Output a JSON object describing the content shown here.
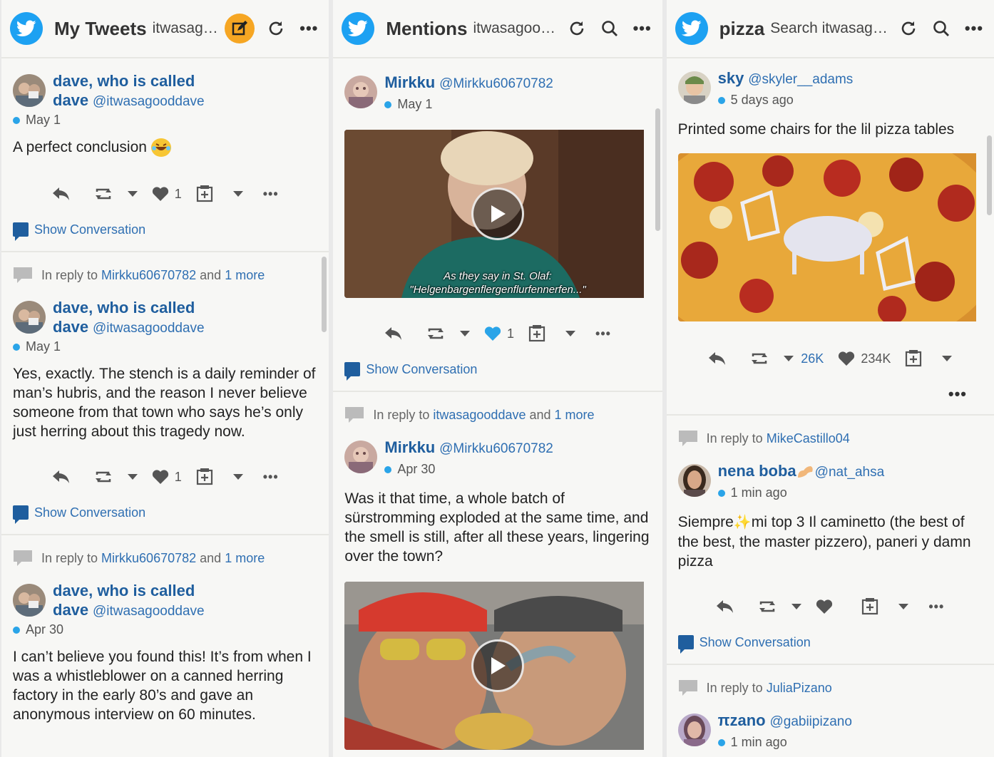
{
  "colors": {
    "accent": "#1da1f2",
    "link": "#2f6fb2",
    "name": "#1f5e9e",
    "compose": "#f6a623",
    "liked": "#2aa4e8"
  },
  "columns": [
    {
      "title": "My Tweets",
      "subtitle": "itwasago…",
      "icons": [
        "twitter-bird-icon",
        "compose-icon",
        "refresh-icon",
        "more-icon"
      ],
      "tweets": [
        {
          "name_line1": "dave, who is called",
          "name_line2": "dave",
          "handle": "@itwasagooddave",
          "time": "May 1",
          "text": "A perfect conclusion",
          "emoji": "laughing-emoji",
          "likes": "1",
          "show_conversation": "Show Conversation"
        },
        {
          "reply_prefix": "In reply to",
          "reply_user": "Mirkku60670782",
          "reply_and": "and",
          "reply_more": "1 more",
          "name_line1": "dave, who is called",
          "name_line2": "dave",
          "handle": "@itwasagooddave",
          "time": "May 1",
          "text": "Yes, exactly. The stench is a daily reminder of man’s hubris, and the reason I never believe someone from that town who says he’s only just herring about this tragedy now.",
          "likes": "1",
          "show_conversation": "Show Conversation"
        },
        {
          "reply_prefix": "In reply to",
          "reply_user": "Mirkku60670782",
          "reply_and": "and",
          "reply_more": "1 more",
          "name_line1": "dave, who is called",
          "name_line2": "dave",
          "handle": "@itwasagooddave",
          "time": "Apr 30",
          "text": "I can’t believe you found this! It’s from when I was a whistleblower on a canned herring factory in the early 80’s and gave an anonymous interview on 60 minutes."
        }
      ]
    },
    {
      "title": "Mentions",
      "subtitle": "itwasagoo…",
      "icons": [
        "twitter-bird-icon",
        "refresh-icon",
        "search-icon",
        "more-icon"
      ],
      "tweets": [
        {
          "name": "Mirkku",
          "handle": "@Mirkku60670782",
          "time": "May 1",
          "video_caption_1": "As they say in St. Olaf:",
          "video_caption_2": "\"Helgenbargenflergenflurfennerfen...\"",
          "likes": "1",
          "show_conversation": "Show Conversation"
        },
        {
          "reply_prefix": "In reply to",
          "reply_user": "itwasagooddave",
          "reply_and": "and",
          "reply_more": "1 more",
          "name": "Mirkku",
          "handle": "@Mirkku60670782",
          "time": "Apr 30",
          "text": "Was it that time, a whole batch of sürstromming exploded at the same time, and the smell is still, after all these years, lingering over the town?"
        }
      ]
    },
    {
      "title": "pizza",
      "subtitle": "Search itwasago…",
      "icons": [
        "twitter-bird-icon",
        "refresh-icon",
        "search-icon",
        "more-icon"
      ],
      "tweets": [
        {
          "name": "sky",
          "handle": "@skyler__adams",
          "time": "5 days ago",
          "text": "Printed some chairs for the lil pizza tables",
          "retweets": "26K",
          "likes": "234K"
        },
        {
          "reply_prefix": "In reply to",
          "reply_user": "MikeCastillo04",
          "name": "nena boba",
          "handle": "@nat_ahsa",
          "time": "1 min ago",
          "text_a": "Siempre",
          "text_b": "mi top 3 Il caminetto (the best of the best, the master pizzero), paneri y damn pizza",
          "show_conversation": "Show Conversation"
        },
        {
          "reply_prefix": "In reply to",
          "reply_user": "JuliaPizano",
          "name": "πzano",
          "handle": "@gabiipizano",
          "time": "1 min ago"
        }
      ]
    }
  ]
}
